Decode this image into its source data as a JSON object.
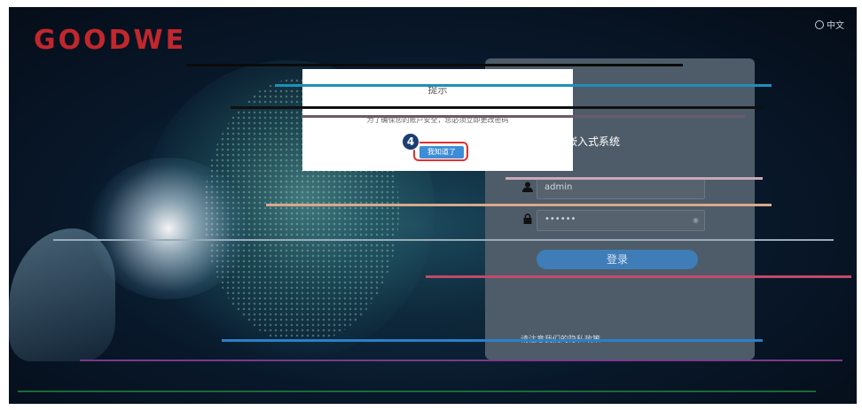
{
  "brand": {
    "logo_text": "GOODWE",
    "logo_color": "#c1272d"
  },
  "header": {
    "language_label": "中文"
  },
  "login": {
    "system_title": "采嵌入式系统",
    "username_value": "admin",
    "password_value": "••••••",
    "login_button": "登录",
    "privacy_link": "请注意我们的隐私政策"
  },
  "dialog": {
    "title": "提示",
    "message": "为了确保您的账户安全，您必须立即更改密码",
    "confirm_button": "我知道了"
  },
  "annotation": {
    "step_number": "4",
    "highlight_color": "#e03030"
  }
}
